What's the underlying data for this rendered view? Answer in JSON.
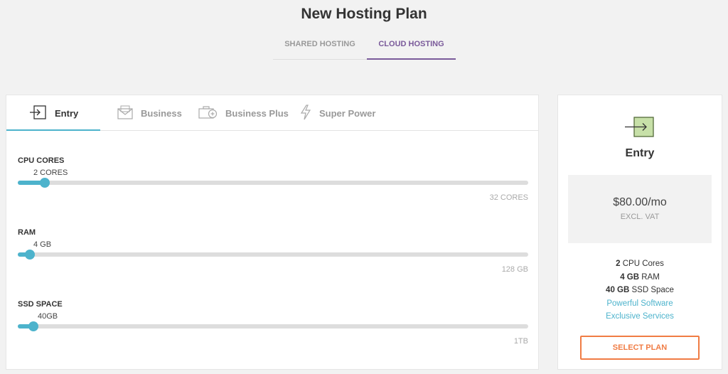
{
  "header": {
    "title": "New Hosting Plan"
  },
  "hosting_tabs": [
    {
      "label": "SHARED HOSTING",
      "active": false
    },
    {
      "label": "CLOUD HOSTING",
      "active": true
    }
  ],
  "plan_tabs": [
    {
      "label": "Entry",
      "icon": "enter-icon",
      "active": true
    },
    {
      "label": "Business",
      "icon": "envelope-icon",
      "active": false
    },
    {
      "label": "Business Plus",
      "icon": "briefcase-plus-icon",
      "active": false
    },
    {
      "label": "Super Power",
      "icon": "lightning-icon",
      "active": false
    }
  ],
  "sliders": {
    "cpu": {
      "label": "CPU CORES",
      "value": "2 CORES",
      "max": "32 CORES",
      "level": 0.053
    },
    "ram": {
      "label": "RAM",
      "value": "4 GB",
      "max": "128 GB",
      "level": 0.023
    },
    "ssd": {
      "label": "SSD SPACE",
      "value": "40GB",
      "max": "1TB",
      "level": 0.03
    }
  },
  "summary": {
    "icon": "enter-icon",
    "plan_name": "Entry",
    "price": "$80.00/mo",
    "vat_note": "EXCL. VAT",
    "features": [
      {
        "bold": "2",
        "text": "CPU Cores"
      },
      {
        "bold": "4 GB",
        "text": "RAM"
      },
      {
        "bold": "40 GB",
        "text": "SSD Space"
      }
    ],
    "links": [
      "Powerful Software",
      "Exclusive Services"
    ],
    "select_label": "SELECT PLAN"
  },
  "colors": {
    "accent": "#4db3cc",
    "active_tab": "#7a5a9a",
    "cta": "#f07c44",
    "icon_fill": "#c7e0a8"
  }
}
